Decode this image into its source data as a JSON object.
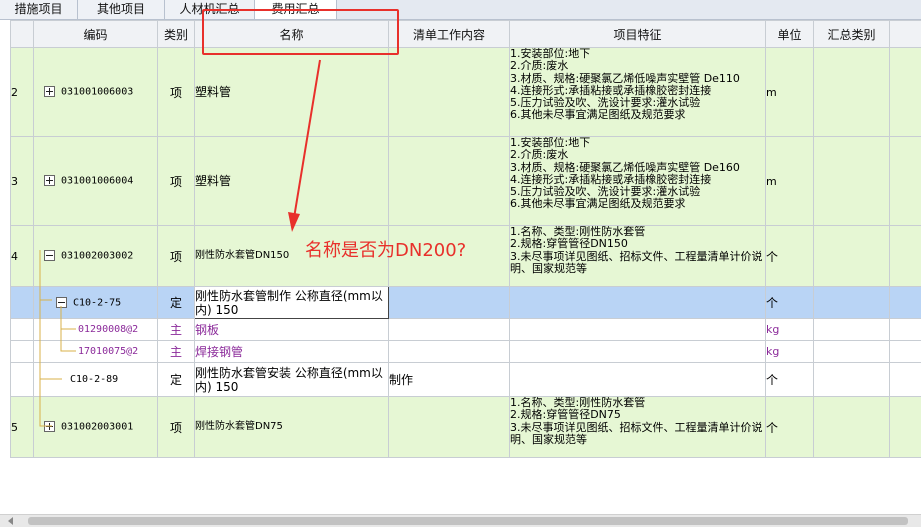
{
  "tabs": [
    "措施项目",
    "其他项目",
    "人材机汇总",
    "费用汇总"
  ],
  "headers": [
    "编码",
    "类别",
    "名称",
    "清单工作内容",
    "项目特征",
    "单位",
    "汇总类别"
  ],
  "rows": [
    {
      "idx": "2",
      "expander": "plus",
      "code": "031001006003",
      "cat": "项",
      "name": "塑料管",
      "work": "",
      "features": [
        "1.安装部位:地下",
        "2.介质:废水",
        "3.材质、规格:硬聚氯乙烯低噪声实壁管 De110",
        "4.连接形式:承插粘接或承插橡胶密封连接",
        "5.压力试验及吹、洗设计要求:灌水试验",
        "6.其他未尽事宜满足图纸及规范要求"
      ],
      "unit": "m"
    },
    {
      "idx": "3",
      "expander": "plus",
      "code": "031001006004",
      "cat": "项",
      "name": "塑料管",
      "work": "",
      "features": [
        "1.安装部位:地下",
        "2.介质:废水",
        "3.材质、规格:硬聚氯乙烯低噪声实壁管 De160",
        "4.连接形式:承插粘接或承插橡胶密封连接",
        "5.压力试验及吹、洗设计要求:灌水试验",
        "6.其他未尽事宜满足图纸及规范要求"
      ],
      "unit": "m"
    },
    {
      "idx": "4",
      "expander": "minus",
      "code": "031002003002",
      "cat": "项",
      "name": "刚性防水套管DN150",
      "work": "",
      "features": [
        "1.名称、类型:刚性防水套管",
        "2.规格:穿管管径DN150",
        "3.未尽事项详见图纸、招标文件、工程量清单计价说明、国家规范等"
      ],
      "unit": "个"
    },
    {
      "idx": "",
      "expander": "minus",
      "code": "C10-2-75",
      "cat": "定",
      "name": "刚性防水套管制作 公称直径(mm以内) 150",
      "work": "",
      "features": [],
      "unit": "个"
    },
    {
      "idx": "",
      "expander": "",
      "code": "01290008@2",
      "cat": "主",
      "name": "钢板",
      "work": "",
      "features": [],
      "unit": "kg"
    },
    {
      "idx": "",
      "expander": "",
      "code": "17010075@2",
      "cat": "主",
      "name": "焊接钢管",
      "work": "",
      "features": [],
      "unit": "kg"
    },
    {
      "idx": "",
      "expander": "",
      "code": "C10-2-89",
      "cat": "定",
      "name": "刚性防水套管安装 公称直径(mm以内) 150",
      "work": "制作",
      "features": [],
      "unit": "个"
    },
    {
      "idx": "5",
      "expander": "plus",
      "code": "031002003001",
      "cat": "项",
      "name": "刚性防水套管DN75",
      "work": "",
      "features": [
        "1.名称、类型:刚性防水套管",
        "2.规格:穿管管径DN75",
        "3.未尽事项详见图纸、招标文件、工程量清单计价说明、国家规范等"
      ],
      "unit": "个"
    }
  ],
  "annotation": {
    "text": "名称是否为DN200?",
    "color": "#e8302b"
  }
}
